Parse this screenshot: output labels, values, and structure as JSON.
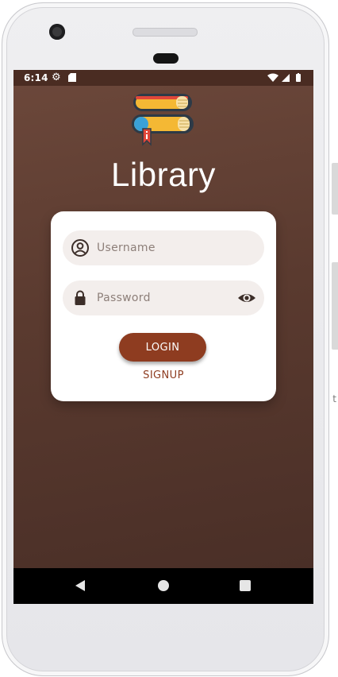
{
  "status_bar": {
    "time": "6:14"
  },
  "app": {
    "title": "Library",
    "logo_icon": "stacked-books-icon"
  },
  "login_form": {
    "username_placeholder": "Username",
    "password_placeholder": "Password",
    "login_label": "LOGIN",
    "signup_label": "SIGNUP"
  },
  "colors": {
    "background_top": "#6b473a",
    "background_bottom": "#4a2f27",
    "accent": "#8e3c20",
    "field_bg": "#f3eeec",
    "card_bg": "#ffffff"
  },
  "device": {
    "edge_glyph": "t"
  }
}
